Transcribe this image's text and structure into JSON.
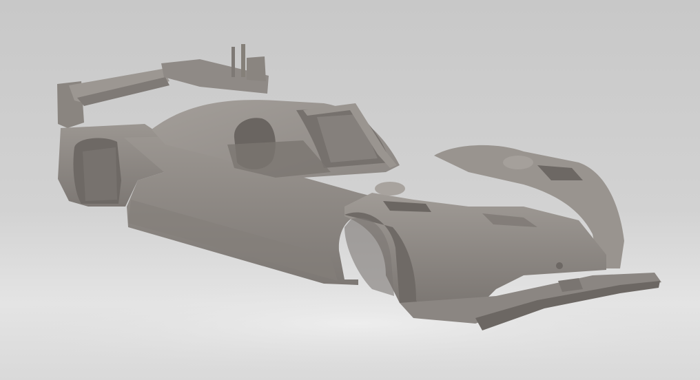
{
  "scene": {
    "subject": "race-car-body-shell-3d-model",
    "colors": {
      "background_top": "#c9c9c9",
      "background_bottom": "#e6e6e6",
      "body_light": "#9a9590",
      "body_mid": "#8a8580",
      "body_dark": "#6f6a66",
      "body_shadow": "#5e5955",
      "floor_glow": "#ececec"
    }
  }
}
